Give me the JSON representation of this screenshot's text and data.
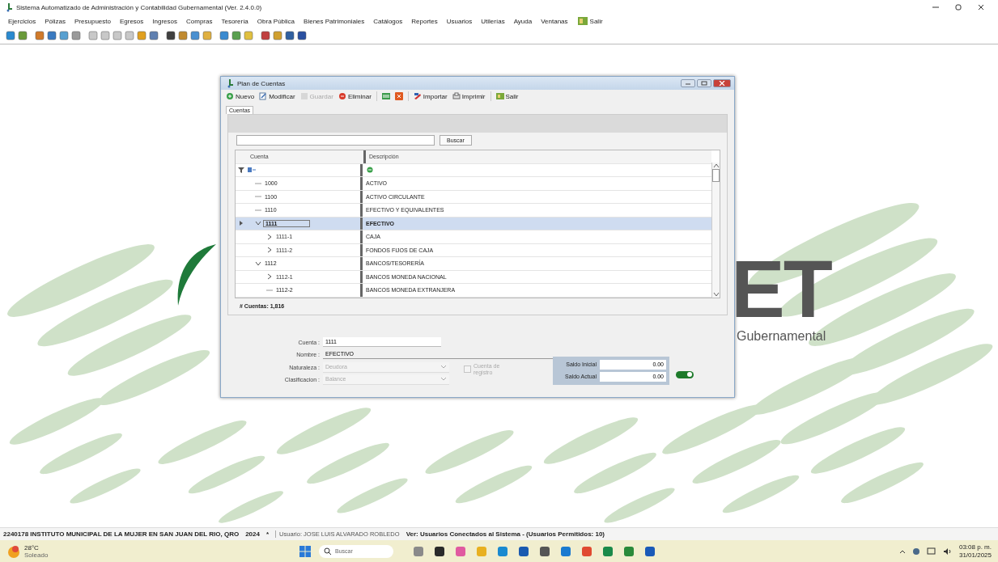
{
  "window": {
    "title": "Sistema Automatizado de Administración y Contabilidad Gubernamental  (Ver. 2.4.0.0)"
  },
  "menu": [
    "Ejercicios",
    "Pólizas",
    "Presupuesto",
    "Egresos",
    "Ingresos",
    "Compras",
    "Tesorería",
    "Obra Pública",
    "Bienes Patrimoniales",
    "Catálogos",
    "Reportes",
    "Usuarios",
    "Utilerías",
    "Ayuda",
    "Ventanas",
    "Salir"
  ],
  "background": {
    "logo_text": "ET",
    "logo_subtitle": "Gubernamental"
  },
  "dialog": {
    "title": "Plan de Cuentas",
    "toolbar": [
      {
        "kind": "text",
        "label": "Nuevo",
        "disabled": false
      },
      {
        "kind": "text",
        "label": "Modificar",
        "disabled": false
      },
      {
        "kind": "text",
        "label": "Guardar",
        "disabled": true
      },
      {
        "kind": "text",
        "label": "Eliminar",
        "disabled": false
      },
      {
        "kind": "icon",
        "disabled": false
      },
      {
        "kind": "icon",
        "disabled": false
      },
      {
        "kind": "text",
        "label": "Importar",
        "disabled": false
      },
      {
        "kind": "text",
        "label": "Imprimir",
        "disabled": false
      },
      {
        "kind": "text",
        "label": "Salir",
        "disabled": false
      }
    ],
    "tabs": [
      {
        "label": "Cuentas",
        "selected": true
      }
    ],
    "search": {
      "button": "Buscar"
    },
    "grid": {
      "columns": [
        "Cuenta",
        "Descripción"
      ],
      "rows": [
        {
          "kind": "leaf",
          "cuenta": "1000",
          "descripcion": "ACTIVO",
          "selected": false
        },
        {
          "kind": "leaf",
          "cuenta": "1100",
          "descripcion": "ACTIVO CIRCULANTE",
          "selected": false
        },
        {
          "kind": "leaf",
          "cuenta": "1110",
          "descripcion": "EFECTIVO Y EQUIVALENTES",
          "selected": false
        },
        {
          "kind": "branch",
          "cuenta": "1111",
          "descripcion": "EFECTIVO",
          "selected": true,
          "expanded": true,
          "children": [
            {
              "kind": "branch",
              "cuenta": "1111-1",
              "descripcion": "CAJA",
              "selected": false,
              "expanded": false
            },
            {
              "kind": "branch",
              "cuenta": "1111-2",
              "descripcion": "FONDOS FIJOS DE CAJA",
              "selected": false,
              "expanded": false
            }
          ]
        },
        {
          "kind": "branch",
          "cuenta": "1112",
          "descripcion": "BANCOS/TESORERÍA",
          "selected": false,
          "expanded": true,
          "children": [
            {
              "kind": "branch",
              "cuenta": "1112-1",
              "descripcion": "BANCOS MONEDA NACIONAL",
              "selected": false,
              "expanded": false
            },
            {
              "kind": "leaf",
              "cuenta": "1112-2",
              "descripcion": "BANCOS MONEDA EXTRANJERA",
              "selected": false
            }
          ]
        }
      ],
      "count": "# Cuentas: 1,816"
    },
    "form": {
      "cuenta_label": "Cuenta :",
      "cuenta": "1111",
      "nombre_label": "Nombre :",
      "nombre": "EFECTIVO",
      "naturaleza_label": "Naturaleza :",
      "naturaleza": "Deudora",
      "naturaleza_disabled": true,
      "clasificacion_label": "Clasificacion :",
      "clasificacion": "Balance",
      "clasificacion_disabled": true,
      "registro": {
        "label": "Cuenta de registro",
        "checked": false,
        "disabled": true
      },
      "saldo_inicial_label": "Saldo Inicial",
      "saldo_inicial": "0.00",
      "saldo_actual_label": "Saldo Actual",
      "saldo_actual": "0.00",
      "toggle": {
        "on": true
      }
    }
  },
  "status_bar": {
    "entity": "2240178 INSTITUTO MUNICIPAL DE LA MUJER EN SAN JUAN DEL RIO, QRO",
    "year": "2024",
    "flag": "*",
    "user": "Usuario: JOSE LUIS ALVARADO ROBLEDO",
    "connected": "Ver: Usuarios Conectados al Sistema - (Usuarios Permitidos: 10)"
  },
  "taskbar": {
    "temperature": "28°C",
    "weather": "Soleado",
    "search_placeholder": "Buscar",
    "time": "03:08 p. m.",
    "date": "31/01/2025"
  }
}
